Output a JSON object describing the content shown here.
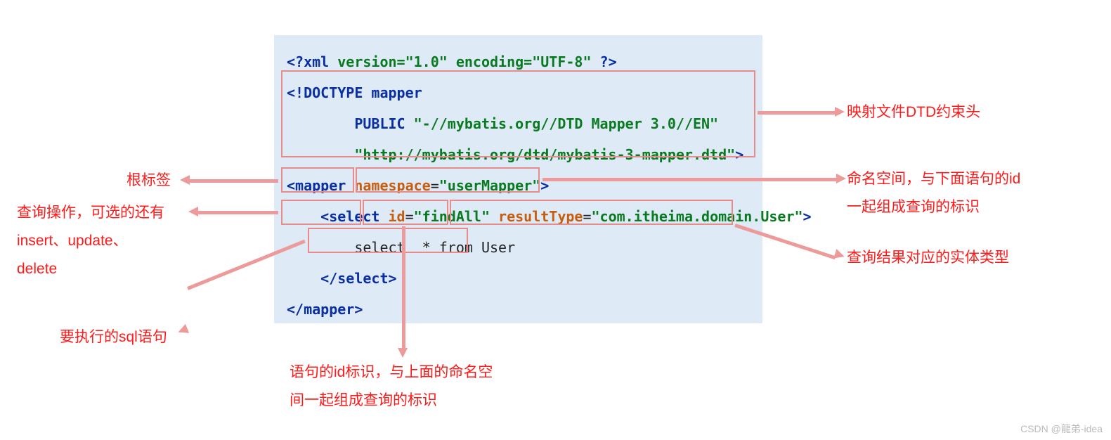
{
  "code": {
    "xml_decl_open": "<?",
    "xml_kw": "xml",
    "xml_attrs": " version=\"1.0\" encoding=\"UTF-8\" ",
    "xml_decl_close": "?>",
    "doctype_open": "<!DOCTYPE ",
    "doctype_name": "mapper",
    "doctype_public_kw": "PUBLIC ",
    "doctype_public_id": "\"-//mybatis.org//DTD Mapper 3.0//EN\"",
    "doctype_system_id": "\"http://mybatis.org/dtd/mybatis-3-mapper.dtd\"",
    "doctype_close": ">",
    "mapper_open1": "<",
    "mapper_tag": "mapper",
    "mapper_ns_attr": " namespace",
    "mapper_ns_eq": "=",
    "mapper_ns_val": "\"userMapper\"",
    "mapper_open2": ">",
    "select_open1": "<",
    "select_tag": "select",
    "select_id_attr": " id",
    "select_id_eq": "=",
    "select_id_val": "\"findAll\"",
    "select_rt_attr": " resultType",
    "select_rt_eq": "=",
    "select_rt_val": "\"com.itheima.domain.User\"",
    "select_open2": ">",
    "sql_text": "select  * from User",
    "select_close": "</select>",
    "mapper_close": "</mapper>"
  },
  "ann": {
    "root_tag": "根标签",
    "query_op": "查询操作，可选的还有\ninsert、update、\ndelete",
    "sql_stmt": "要执行的sql语句",
    "dtd_head": "映射文件DTD约束头",
    "namespace": "命名空间，与下面语句的id\n一起组成查询的标识",
    "result_type": "查询结果对应的实体类型",
    "stmt_id": "语句的id标识，与上面的命名空\n间一起组成查询的标识"
  },
  "watermark": "CSDN @龍弟-idea"
}
